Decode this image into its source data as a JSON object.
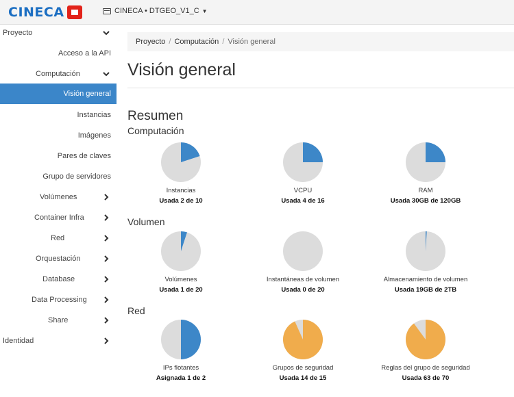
{
  "brand": {
    "logo_text": "CINECA"
  },
  "project_switcher": {
    "label": "CINECA • DTGEO_V1_C"
  },
  "sidebar": {
    "items": [
      {
        "label": "Proyecto",
        "level": 0,
        "chevron": "down"
      },
      {
        "label": "Acceso a la API",
        "level": 2
      },
      {
        "label": "Computación",
        "level": 1,
        "chevron": "down"
      },
      {
        "label": "Visión general",
        "level": 2,
        "active": true
      },
      {
        "label": "Instancias",
        "level": 2
      },
      {
        "label": "Imágenes",
        "level": 2
      },
      {
        "label": "Pares de claves",
        "level": 2
      },
      {
        "label": "Grupo de servidores",
        "level": 2
      },
      {
        "label": "Volúmenes",
        "level": 1,
        "chevron": "right"
      },
      {
        "label": "Container Infra",
        "level": 1,
        "chevron": "right"
      },
      {
        "label": "Red",
        "level": 1,
        "chevron": "right"
      },
      {
        "label": "Orquestación",
        "level": 1,
        "chevron": "right"
      },
      {
        "label": "Database",
        "level": 1,
        "chevron": "right"
      },
      {
        "label": "Data Processing",
        "level": 1,
        "chevron": "right"
      },
      {
        "label": "Share",
        "level": 1,
        "chevron": "right"
      },
      {
        "label": "Identidad",
        "level": 0,
        "chevron": "right"
      }
    ]
  },
  "breadcrumb": {
    "part1": "Proyecto",
    "part2": "Computación",
    "part3": "Visión general"
  },
  "page": {
    "title": "Visión general",
    "summary_heading": "Resumen"
  },
  "colors": {
    "used": "#3d87c8",
    "near_full": "#f0ac4c",
    "free": "#dcdcdc",
    "active_nav": "#3b86c9"
  },
  "sections": [
    {
      "heading": "Computación",
      "charts": [
        {
          "name": "Instancias",
          "usage": "Usada 2 de 10",
          "fraction": 0.2,
          "color": "#3d87c8"
        },
        {
          "name": "VCPU",
          "usage": "Usada 4 de 16",
          "fraction": 0.25,
          "color": "#3d87c8"
        },
        {
          "name": "RAM",
          "usage": "Usada 30GB de 120GB",
          "fraction": 0.25,
          "color": "#3d87c8"
        }
      ]
    },
    {
      "heading": "Volumen",
      "charts": [
        {
          "name": "Volúmenes",
          "usage": "Usada 1 de 20",
          "fraction": 0.05,
          "color": "#3d87c8"
        },
        {
          "name": "Instantáneas de volumen",
          "usage": "Usada 0 de 20",
          "fraction": 0,
          "color": "#3d87c8"
        },
        {
          "name": "Almacenamiento de volumen",
          "usage": "Usada 19GB de 2TB",
          "fraction": 0.0095,
          "color": "#3d87c8"
        }
      ]
    },
    {
      "heading": "Red",
      "charts": [
        {
          "name": "IPs flotantes",
          "usage": "Asignada 1 de 2",
          "fraction": 0.5,
          "color": "#3d87c8"
        },
        {
          "name": "Grupos de seguridad",
          "usage": "Usada 14 de 15",
          "fraction": 0.9333,
          "color": "#f0ac4c"
        },
        {
          "name": "Reglas del grupo de seguridad",
          "usage": "Usada 63 de 70",
          "fraction": 0.9,
          "color": "#f0ac4c"
        }
      ]
    }
  ]
}
